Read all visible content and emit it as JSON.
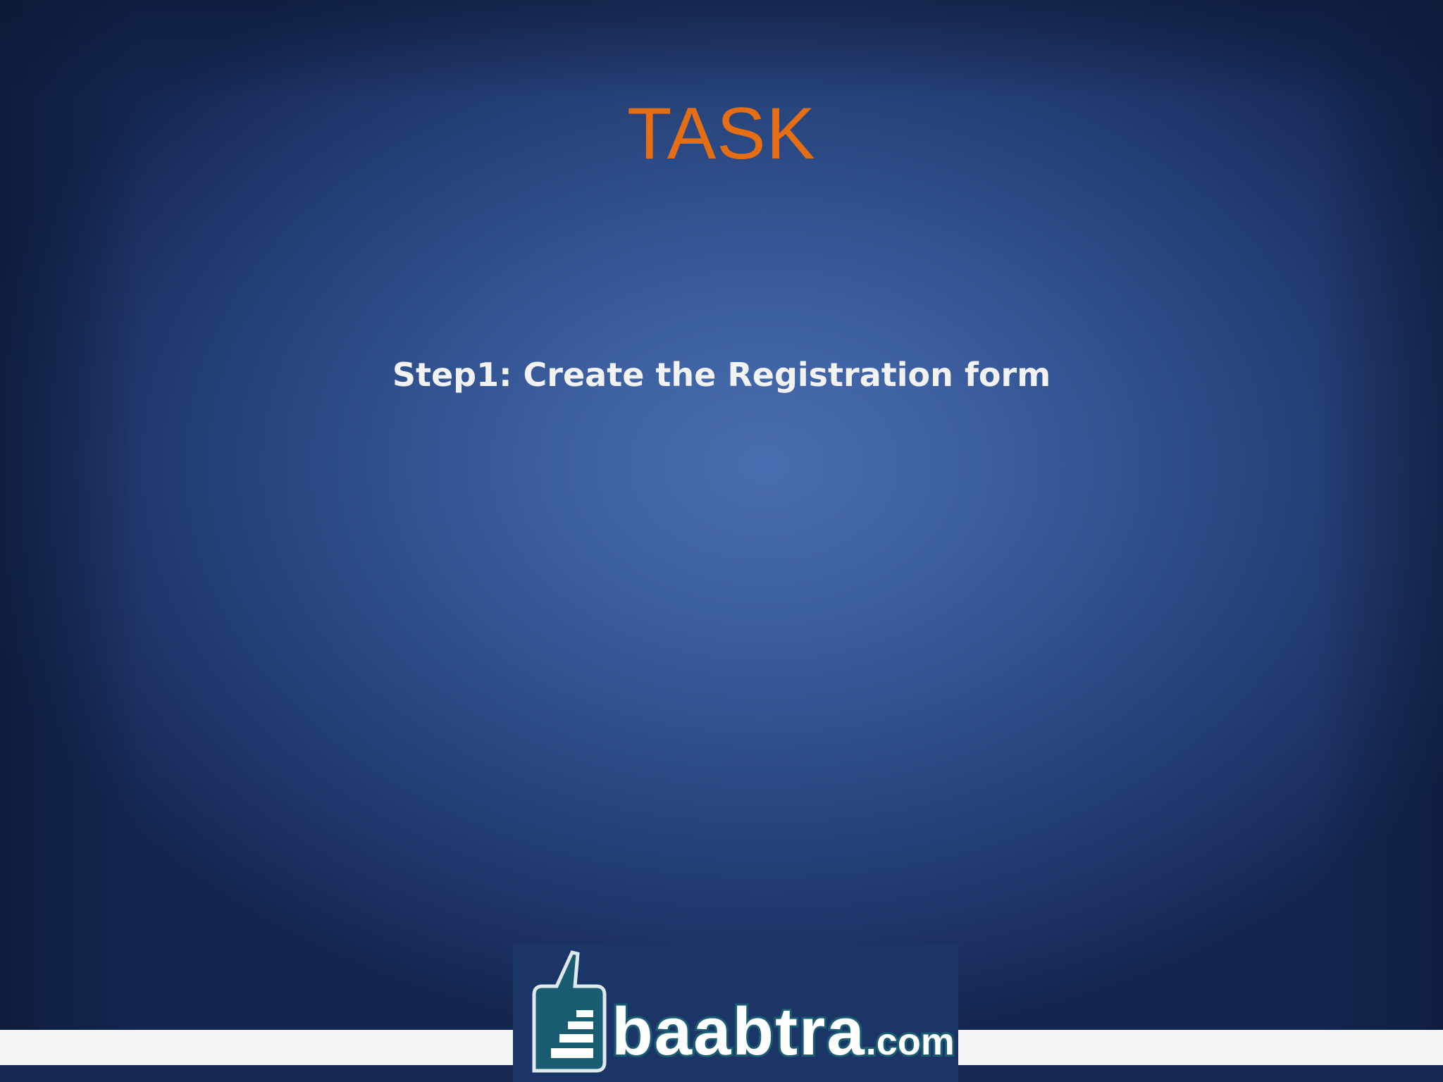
{
  "slide": {
    "title": "TASK",
    "step_text": "Step1: Create the Registration form"
  },
  "logo": {
    "name": "baabtra",
    "suffix": ".com"
  },
  "colors": {
    "title": "#e56d14",
    "text": "#f2f2f2",
    "background_center": "#4a6db0",
    "background_edge": "#132650",
    "footer_bar": "#f4f5f7",
    "logo_teal": "#1a5c72"
  }
}
